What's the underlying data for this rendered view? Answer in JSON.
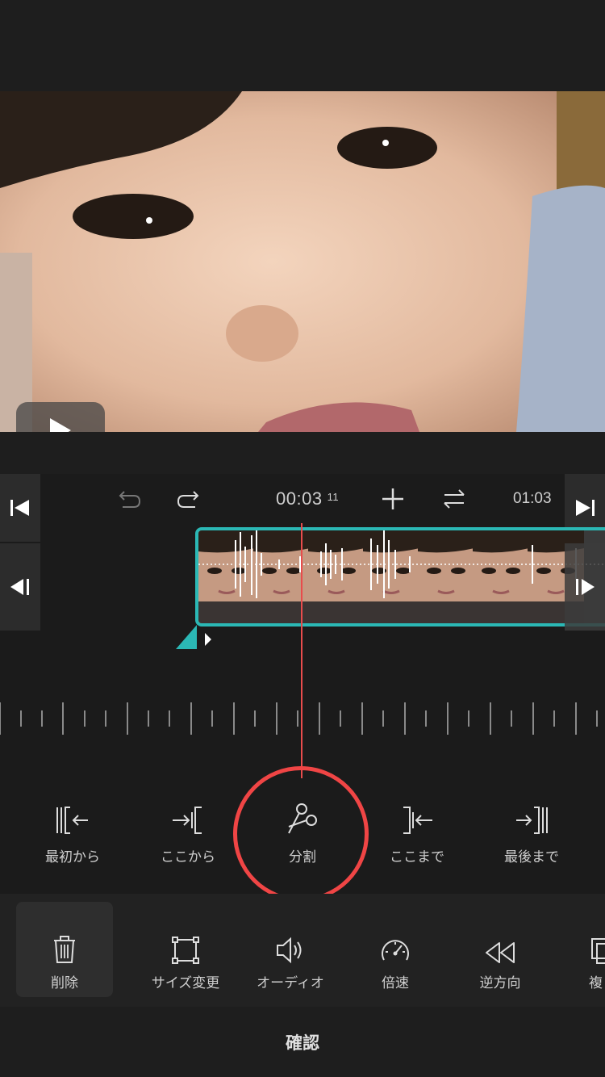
{
  "player": {
    "current_time": "00:03",
    "current_frame": "11",
    "end_time": "01:03"
  },
  "actions": [
    {
      "label": "最初から",
      "icon": "trim-from-start-icon"
    },
    {
      "label": "ここから",
      "icon": "trim-from-here-icon"
    },
    {
      "label": "分割",
      "icon": "split-icon"
    },
    {
      "label": "ここまで",
      "icon": "trim-to-here-icon"
    },
    {
      "label": "最後まで",
      "icon": "trim-to-end-icon"
    }
  ],
  "tools": [
    {
      "label": "削除",
      "icon": "trash-icon",
      "active": true
    },
    {
      "label": "サイズ変更",
      "icon": "resize-icon"
    },
    {
      "label": "オーディオ",
      "icon": "audio-icon"
    },
    {
      "label": "倍速",
      "icon": "speedometer-icon"
    },
    {
      "label": "逆方向",
      "icon": "reverse-icon"
    },
    {
      "label": "複",
      "icon": "duplicate-icon"
    }
  ],
  "confirm_label": "確認",
  "colors": {
    "accent_teal": "#2bb8b5",
    "playhead_red": "#e84c4c",
    "highlight_red": "#f04545"
  }
}
